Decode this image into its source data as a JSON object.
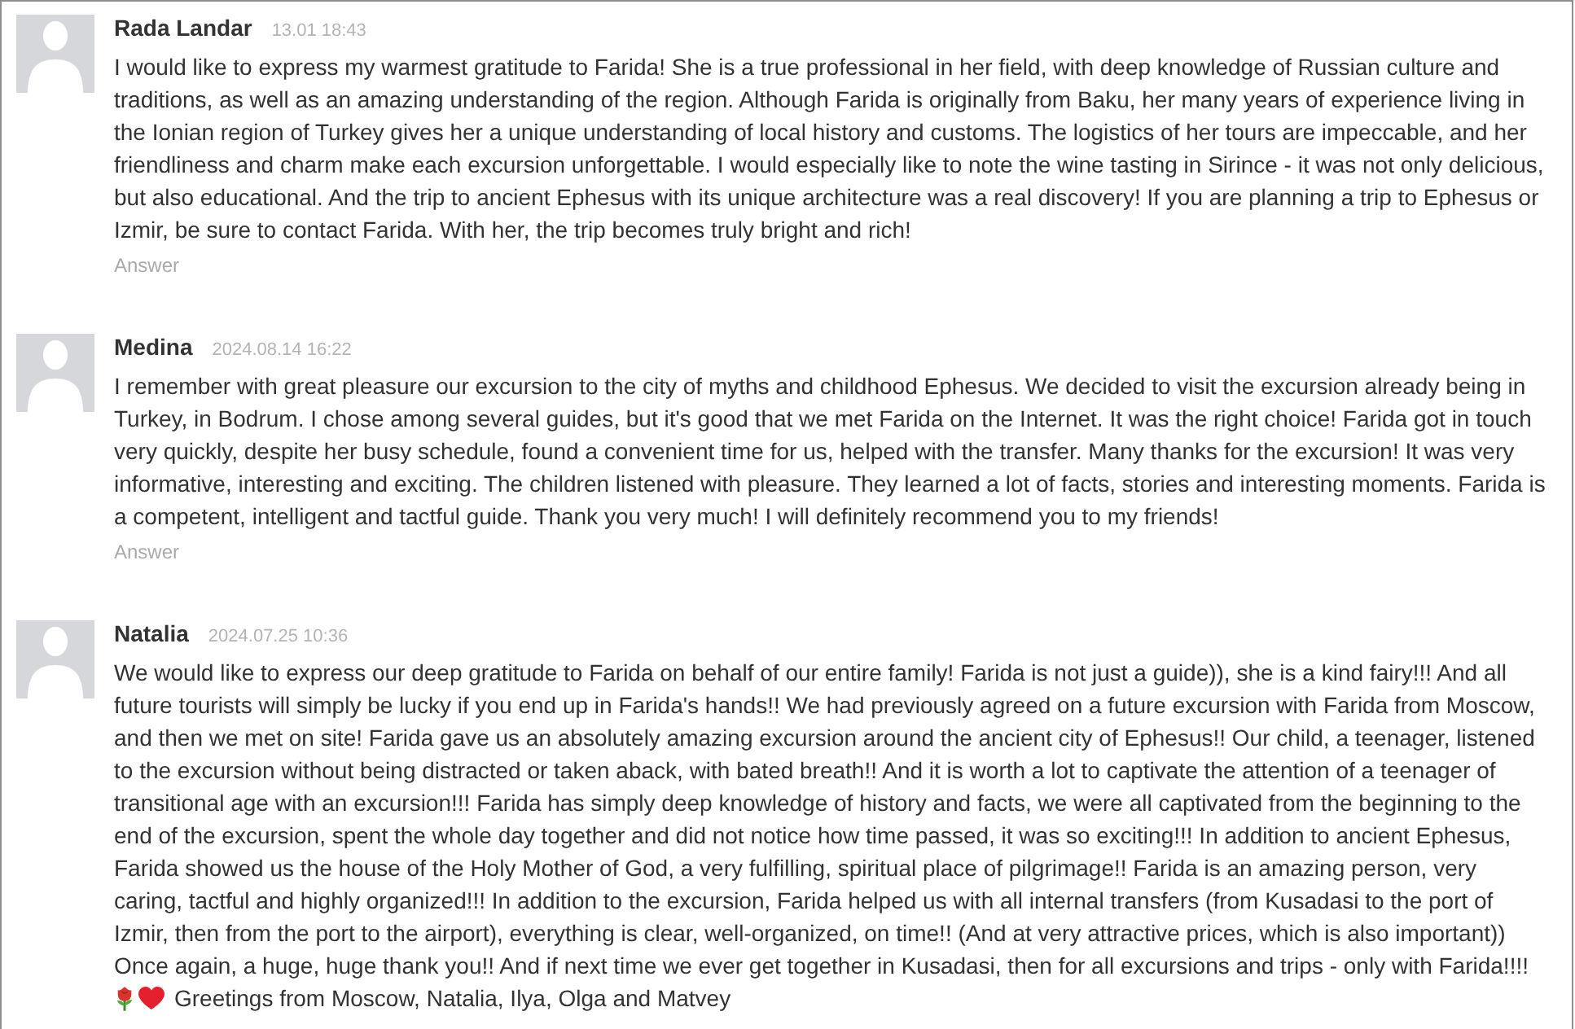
{
  "comments": [
    {
      "author": "Rada Landar",
      "date": "13.01 18:43",
      "body": "I would like to express my warmest gratitude to Farida! She is a true professional in her field, with deep knowledge of Russian culture and traditions, as well as an amazing understanding of the region. Although Farida is originally from Baku, her many years of experience living in the Ionian region of Turkey gives her a unique understanding of local history and customs. The logistics of her tours are impeccable, and her friendliness and charm make each excursion unforgettable. I would especially like to note the wine tasting in Sirince - it was not only delicious, but also educational. And the trip to ancient Ephesus with its unique architecture was a real discovery! If you are planning a trip to Ephesus or Izmir, be sure to contact Farida. With her, the trip becomes truly bright and rich!",
      "answer_label": "Answer"
    },
    {
      "author": "Medina",
      "date": "2024.08.14 16:22",
      "body": "I remember with great pleasure our excursion to the city of myths and childhood Ephesus. We decided to visit the excursion already being in Turkey, in Bodrum. I chose among several guides, but it's good that we met Farida on the Internet. It was the right choice! Farida got in touch very quickly, despite her busy schedule, found a convenient time for us, helped with the transfer. Many thanks for the excursion! It was very informative, interesting and exciting. The children listened with pleasure. They learned a lot of facts, stories and interesting moments. Farida is a competent, intelligent and tactful guide. Thank you very much! I will definitely recommend you to my friends!",
      "answer_label": "Answer"
    },
    {
      "author": "Natalia",
      "date": "2024.07.25 10:36",
      "body": "We would like to express our deep gratitude to Farida on behalf of our entire family! Farida is not just a guide)), she is a kind fairy!!! And all future tourists will simply be lucky if you end up in Farida's hands!! We had previously agreed on a future excursion with Farida from Moscow, and then we met on site! Farida gave us an absolutely amazing excursion around the ancient city of Ephesus!! Our child, a teenager, listened to the excursion without being distracted or taken aback, with bated breath!! And it is worth a lot to captivate the attention of a teenager of transitional age with an excursion!!! Farida has simply deep knowledge of history and facts, we were all captivated from the beginning to the end of the excursion, spent the whole day together and did not notice how time passed, it was so exciting!!! In addition to ancient Ephesus, Farida showed us the house of the Holy Mother of God, a very fulfilling, spiritual place of pilgrimage!! Farida is an amazing person, very caring, tactful and highly organized!!! In addition to the excursion, Farida helped us with all internal transfers (from Kusadasi to the port of Izmir, then from the port to the airport), everything is clear, well-organized, on time!! (And at very attractive prices, which is also important)) Once again, a huge, huge thank you!! And if next time we ever get together in Kusadasi, then for all excursions and trips - only with Farida!!!!",
      "signature": "Greetings from Moscow, Natalia, Ilya, Olga and Matvey"
    }
  ]
}
